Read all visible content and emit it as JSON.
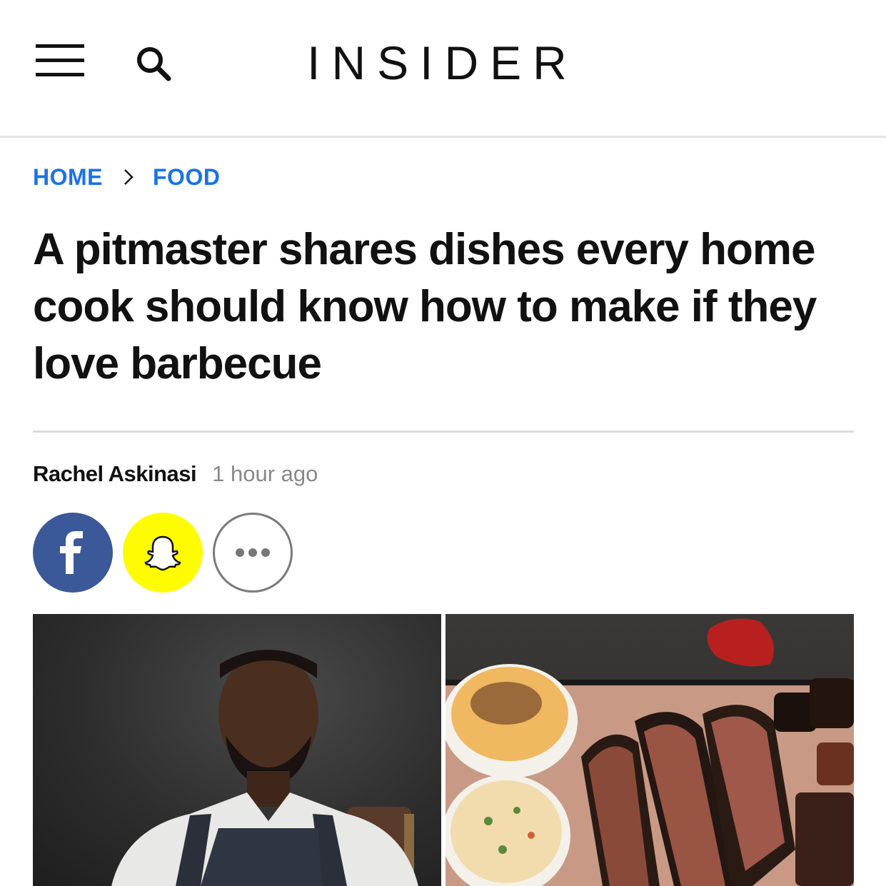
{
  "header": {
    "logo": "INSIDER",
    "menu_icon": "hamburger-menu-icon",
    "search_icon": "search-icon"
  },
  "breadcrumb": {
    "items": [
      {
        "label": "HOME"
      },
      {
        "label": "FOOD"
      }
    ],
    "separator_icon": "chevron-right-icon"
  },
  "article": {
    "title": "A pitmaster shares dishes every home cook should know how to make if they love barbecue",
    "author": "Rachel Askinasi",
    "published": "1 hour ago"
  },
  "share": {
    "facebook_icon": "facebook-icon",
    "snapchat_icon": "snapchat-icon",
    "more_icon": "more-options-icon"
  },
  "colors": {
    "link": "#1a73e8",
    "facebook": "#3b5998",
    "snapchat": "#fffc00",
    "text": "#111111",
    "muted": "#888888"
  }
}
